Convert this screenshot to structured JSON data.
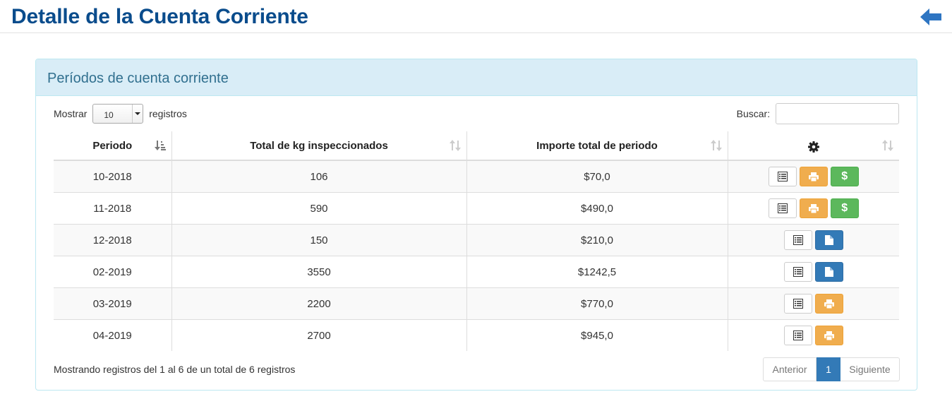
{
  "header": {
    "title": "Detalle de la Cuenta Corriente",
    "back_icon": "arrow-left-icon",
    "accent": "#0a4c8c"
  },
  "panel": {
    "title": "Períodos de cuenta corriente"
  },
  "length": {
    "prefix": "Mostrar",
    "value": "10",
    "suffix": "registros"
  },
  "search": {
    "label": "Buscar:",
    "value": ""
  },
  "table": {
    "columns": [
      "Periodo",
      "Total de kg inspeccionados",
      "Importe total de periodo"
    ],
    "actions_header_icon": "gear-icon",
    "rows": [
      {
        "periodo": "10-2018",
        "kg": "106",
        "importe": "$70,0",
        "actions": [
          "detail",
          "print",
          "pay"
        ]
      },
      {
        "periodo": "11-2018",
        "kg": "590",
        "importe": "$490,0",
        "actions": [
          "detail",
          "print",
          "pay"
        ]
      },
      {
        "periodo": "12-2018",
        "kg": "150",
        "importe": "$210,0",
        "actions": [
          "detail",
          "document"
        ]
      },
      {
        "periodo": "02-2019",
        "kg": "3550",
        "importe": "$1242,5",
        "actions": [
          "detail",
          "document"
        ]
      },
      {
        "periodo": "03-2019",
        "kg": "2200",
        "importe": "$770,0",
        "actions": [
          "detail",
          "print"
        ]
      },
      {
        "periodo": "04-2019",
        "kg": "2700",
        "importe": "$945,0",
        "actions": [
          "detail",
          "print"
        ]
      }
    ],
    "pay_label": "$"
  },
  "footer": {
    "info": "Mostrando registros del 1 al 6 de un total de 6 registros",
    "prev": "Anterior",
    "page": "1",
    "next": "Siguiente"
  }
}
